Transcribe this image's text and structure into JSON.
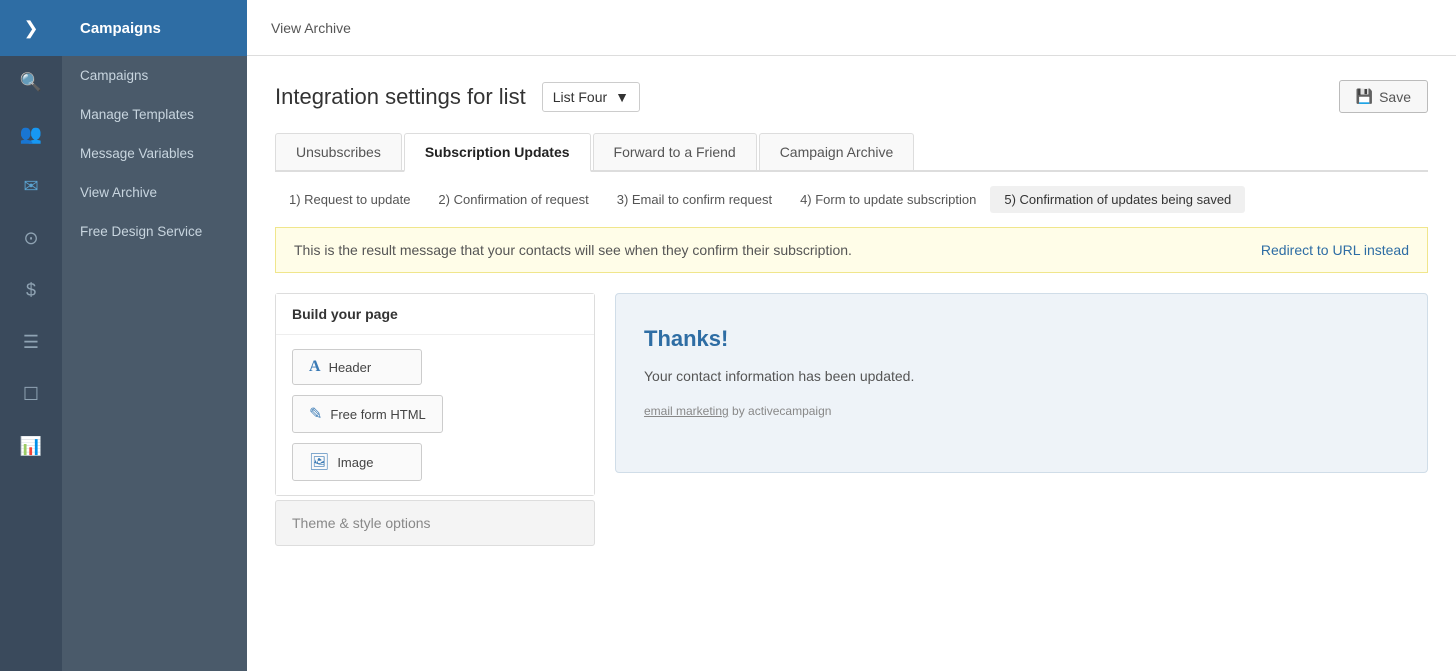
{
  "icon_sidebar": {
    "arrow_icon": "❯",
    "icons": [
      "🔍",
      "👥",
      "✉",
      "⊙",
      "$",
      "☰",
      "☐",
      "📊"
    ]
  },
  "left_nav": {
    "header": "Campaigns",
    "items": [
      {
        "label": "Campaigns"
      },
      {
        "label": "Manage Templates"
      },
      {
        "label": "Message Variables"
      },
      {
        "label": "View Archive"
      },
      {
        "label": "Free Design Service"
      }
    ]
  },
  "topbar": {
    "title": "View Archive"
  },
  "page": {
    "heading": "Integration settings for list",
    "list_dropdown": "List Four",
    "save_button": "Save"
  },
  "tabs": [
    {
      "label": "Unsubscribes",
      "active": false
    },
    {
      "label": "Subscription Updates",
      "active": true
    },
    {
      "label": "Forward to a Friend",
      "active": false
    },
    {
      "label": "Campaign Archive",
      "active": false
    }
  ],
  "steps": [
    {
      "label": "1) Request to update",
      "active": false
    },
    {
      "label": "2) Confirmation of request",
      "active": false
    },
    {
      "label": "3) Email to confirm request",
      "active": false
    },
    {
      "label": "4) Form to update subscription",
      "active": false
    },
    {
      "label": "5) Confirmation of updates being saved",
      "active": true
    }
  ],
  "info_bar": {
    "message": "This is the result message that your contacts will see when they confirm their subscription.",
    "link": "Redirect to URL instead"
  },
  "builder": {
    "panel_title": "Build your page",
    "blocks": [
      {
        "icon": "A",
        "label": "Header"
      },
      {
        "icon": "✎",
        "label": "Free form HTML"
      },
      {
        "icon": "🖼",
        "label": "Image"
      }
    ],
    "theme_label": "Theme & style options"
  },
  "preview": {
    "heading": "Thanks!",
    "body": "Your contact information has been updated.",
    "footer_text": "email marketing",
    "footer_suffix": " by activecampaign"
  }
}
